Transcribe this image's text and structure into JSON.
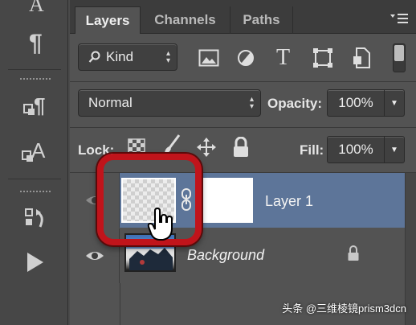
{
  "tabs": [
    {
      "label": "Layers",
      "active": true
    },
    {
      "label": "Channels",
      "active": false
    },
    {
      "label": "Paths",
      "active": false
    }
  ],
  "filter": {
    "kind_label": "Kind",
    "icons": [
      "image-filter-icon",
      "adjustment-filter-icon",
      "type-filter-icon",
      "shape-filter-icon",
      "smart-object-filter-icon"
    ]
  },
  "blend": {
    "mode": "Normal",
    "opacity_label": "Opacity:",
    "opacity_value": "100%"
  },
  "lock": {
    "label": "Lock:",
    "fill_label": "Fill:",
    "fill_value": "100%"
  },
  "layers": [
    {
      "name": "Layer 1",
      "selected": true
    },
    {
      "name": "Background",
      "locked": true
    }
  ],
  "watermark": "头条 @三维棱镜prism3dcn",
  "colors": {
    "selected_row": "#5d7599",
    "highlight_ring": "#c0141b",
    "panel": "#535353"
  }
}
